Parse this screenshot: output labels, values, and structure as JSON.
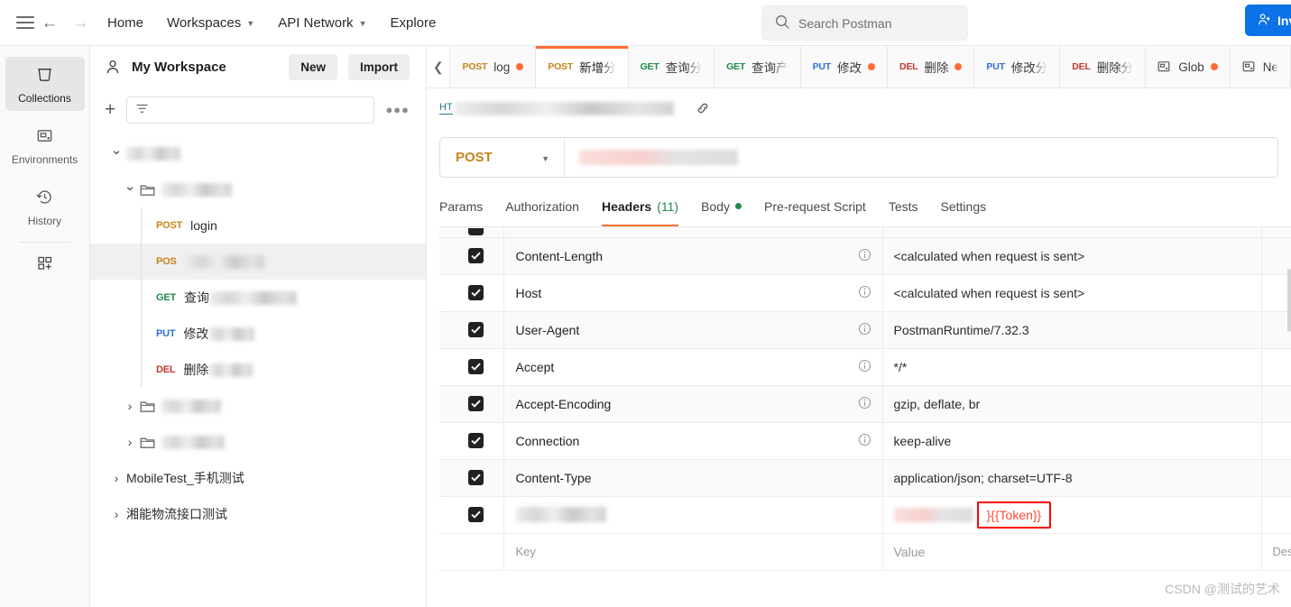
{
  "topnav": {
    "menu_icon": "hamburger-icon",
    "back_icon": "arrow-left-icon",
    "forward_icon": "arrow-right-icon",
    "links": [
      {
        "label": "Home",
        "has_caret": false
      },
      {
        "label": "Workspaces",
        "has_caret": true
      },
      {
        "label": "API Network",
        "has_caret": true
      },
      {
        "label": "Explore",
        "has_caret": false
      }
    ],
    "search_placeholder": "Search Postman",
    "search_icon": "search-icon",
    "invite_label": "Invite",
    "invite_icon": "person-add-icon",
    "invite_color": "#0b72e7"
  },
  "rail": {
    "items": [
      {
        "label": "Collections",
        "icon": "collections-icon",
        "active": true
      },
      {
        "label": "Environments",
        "icon": "environments-icon",
        "active": false
      },
      {
        "label": "History",
        "icon": "history-icon",
        "active": false
      }
    ],
    "add_icon": "apps-grid-plus-icon"
  },
  "workspace": {
    "name": "My Workspace",
    "avatar_icon": "person-icon",
    "new_label": "New",
    "import_label": "Import"
  },
  "collections": {
    "add_icon": "plus-icon",
    "filter_icon": "filter-icon",
    "more_icon": "ellipsis-icon",
    "filter_placeholder": "",
    "tree": [
      {
        "id": "root",
        "depth": 0,
        "type": "collection",
        "label": "",
        "redacted": true,
        "redacted_width": 60,
        "expanded": true,
        "selected": false
      },
      {
        "id": "folder-1",
        "depth": 1,
        "type": "folder",
        "label": "",
        "redacted": true,
        "redacted_width": 78,
        "expanded": true,
        "selected": false
      },
      {
        "id": "req-login",
        "depth": 2,
        "type": "request",
        "method": "POST",
        "label": "login",
        "redacted": false,
        "selected": false
      },
      {
        "id": "req-post-2",
        "depth": 2,
        "type": "request",
        "method": "POS",
        "label": "",
        "redacted": true,
        "redacted_width": 88,
        "selected": true
      },
      {
        "id": "req-get-1",
        "depth": 2,
        "type": "request",
        "method": "GET",
        "label": "查询",
        "redacted": true,
        "redacted_width": 96,
        "selected": false
      },
      {
        "id": "req-put-1",
        "depth": 2,
        "type": "request",
        "method": "PUT",
        "label": "修改",
        "redacted": true,
        "redacted_width": 50,
        "selected": false
      },
      {
        "id": "req-del-1",
        "depth": 2,
        "type": "request",
        "method": "DEL",
        "label": "删除",
        "redacted": true,
        "redacted_width": 48,
        "selected": false
      },
      {
        "id": "folder-2",
        "depth": 1,
        "type": "folder",
        "label": "",
        "redacted": true,
        "redacted_width": 66,
        "expanded": false,
        "selected": false
      },
      {
        "id": "folder-3",
        "depth": 1,
        "type": "folder",
        "label": "",
        "redacted": true,
        "redacted_width": 70,
        "expanded": false,
        "selected": false
      },
      {
        "id": "coll-mobile",
        "depth": 0,
        "type": "collection",
        "label": "MobileTest_手机测试",
        "redacted": false,
        "expanded": false,
        "selected": false
      },
      {
        "id": "coll-xiangneng",
        "depth": 0,
        "type": "collection",
        "label": "湘能物流接口测试",
        "redacted": false,
        "expanded": false,
        "selected": false
      }
    ]
  },
  "tabstrip": {
    "collapse_icon": "chevron-left-icon",
    "tabs": [
      {
        "method": "POST",
        "label": "log",
        "type": "request",
        "unsaved": true,
        "active": false,
        "faded": false
      },
      {
        "method": "POST",
        "label": "新增分",
        "type": "request",
        "unsaved": false,
        "active": true,
        "faded": true
      },
      {
        "method": "GET",
        "label": "查询分",
        "type": "request",
        "unsaved": false,
        "active": false,
        "faded": true
      },
      {
        "method": "GET",
        "label": "查询产",
        "type": "request",
        "unsaved": false,
        "active": false,
        "faded": true
      },
      {
        "method": "PUT",
        "label": "修改",
        "type": "request",
        "unsaved": true,
        "active": false,
        "faded": false
      },
      {
        "method": "DEL",
        "label": "删除",
        "type": "request",
        "unsaved": true,
        "active": false,
        "faded": false
      },
      {
        "method": "PUT",
        "label": "修改分",
        "type": "request",
        "unsaved": false,
        "active": false,
        "faded": true
      },
      {
        "method": "DEL",
        "label": "删除分",
        "type": "request",
        "unsaved": false,
        "active": false,
        "faded": true
      },
      {
        "method": "",
        "label": "Glob",
        "type": "environment",
        "unsaved": true,
        "active": false,
        "faded": false
      },
      {
        "method": "",
        "label": "Ne",
        "type": "environment",
        "unsaved": false,
        "active": false,
        "faded": true
      }
    ]
  },
  "request": {
    "breadcrumb_prefix": "HT",
    "breadcrumb_redacted": true,
    "link_icon": "link-icon",
    "method": "POST",
    "method_caret": "chevron-down-icon",
    "url_redacted": true,
    "url_value": "",
    "tabs": [
      {
        "label": "Params",
        "active": false,
        "count": "",
        "dot": false
      },
      {
        "label": "Authorization",
        "active": false,
        "count": "",
        "dot": false
      },
      {
        "label": "Headers",
        "active": true,
        "count": "(11)",
        "dot": false
      },
      {
        "label": "Body",
        "active": false,
        "count": "",
        "dot": true
      },
      {
        "label": "Pre-request Script",
        "active": false,
        "count": "",
        "dot": false
      },
      {
        "label": "Tests",
        "active": false,
        "count": "",
        "dot": false
      },
      {
        "label": "Settings",
        "active": false,
        "count": "",
        "dot": false
      }
    ]
  },
  "headers_table": {
    "columns": [
      "Key",
      "Value",
      "Description"
    ],
    "new_row_key_placeholder": "Key",
    "new_row_value_placeholder": "Value",
    "new_row_desc_placeholder": "Des",
    "info_icon": "info-icon",
    "rows": [
      {
        "checked": true,
        "key": "Content-Length",
        "value": "<calculated when request is sent>",
        "info": true,
        "key_redacted": false,
        "value_redacted": false,
        "highlight": false
      },
      {
        "checked": true,
        "key": "Host",
        "value": "<calculated when request is sent>",
        "info": true,
        "key_redacted": false,
        "value_redacted": false,
        "highlight": false
      },
      {
        "checked": true,
        "key": "User-Agent",
        "value": "PostmanRuntime/7.32.3",
        "info": true,
        "key_redacted": false,
        "value_redacted": false,
        "highlight": false
      },
      {
        "checked": true,
        "key": "Accept",
        "value": "*/*",
        "info": true,
        "key_redacted": false,
        "value_redacted": false,
        "highlight": false
      },
      {
        "checked": true,
        "key": "Accept-Encoding",
        "value": "gzip, deflate, br",
        "info": true,
        "key_redacted": false,
        "value_redacted": false,
        "highlight": false
      },
      {
        "checked": true,
        "key": "Connection",
        "value": "keep-alive",
        "info": true,
        "key_redacted": false,
        "value_redacted": false,
        "highlight": false
      },
      {
        "checked": true,
        "key": "Content-Type",
        "value": "application/json; charset=UTF-8",
        "info": false,
        "key_redacted": false,
        "value_redacted": false,
        "highlight": false
      },
      {
        "checked": true,
        "key": "",
        "value": "}{{Token}}",
        "info": false,
        "key_redacted": true,
        "value_redacted": true,
        "highlight": true
      }
    ],
    "highlight_color": "#ff0000",
    "token_text_color": "#ff4a35"
  },
  "watermark": "CSDN @测试的艺术"
}
